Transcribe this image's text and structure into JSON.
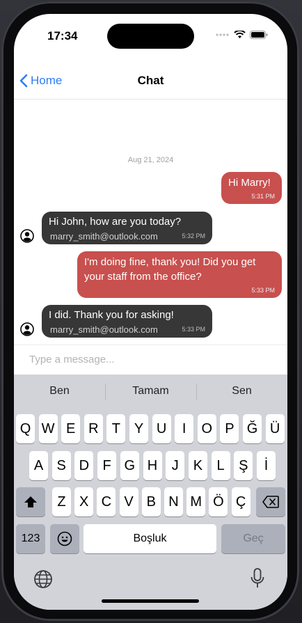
{
  "status": {
    "time": "17:34"
  },
  "nav": {
    "back_label": "Home",
    "title": "Chat"
  },
  "chat": {
    "date": "Aug 21, 2024",
    "messages": [
      {
        "dir": "out",
        "text": "Hi Marry!",
        "time": "5:31 PM"
      },
      {
        "dir": "in",
        "text": "Hi John, how are you today?",
        "sender": "marry_smith@outlook.com",
        "time": "5:32 PM"
      },
      {
        "dir": "out",
        "text": "I'm doing fine, thank you! Did you get your staff from the office?",
        "time": "5:33 PM"
      },
      {
        "dir": "in",
        "text": "I did. Thank you for asking!",
        "sender": "marry_smith@outlook.com",
        "time": "5:33 PM"
      }
    ]
  },
  "composer": {
    "placeholder": "Type a message..."
  },
  "keyboard": {
    "suggestions": [
      "Ben",
      "Tamam",
      "Sen"
    ],
    "row1": [
      "Q",
      "W",
      "E",
      "R",
      "T",
      "Y",
      "U",
      "I",
      "O",
      "P",
      "Ğ",
      "Ü"
    ],
    "row2": [
      "A",
      "S",
      "D",
      "F",
      "G",
      "H",
      "J",
      "K",
      "L",
      "Ş",
      "İ"
    ],
    "row3": [
      "Z",
      "X",
      "C",
      "V",
      "B",
      "N",
      "M",
      "Ö",
      "Ç"
    ],
    "numbers_label": "123",
    "space_label": "Boşluk",
    "return_label": "Geç",
    "icons": {
      "shift": "shift-icon",
      "delete": "backspace-icon",
      "emoji": "emoji-icon",
      "globe": "globe-icon",
      "mic": "microphone-icon"
    }
  },
  "colors": {
    "accent": "#2f7cf6",
    "outgoing": "#c8504e",
    "incoming": "#373737",
    "keyboard_bg": "#d1d3d9"
  }
}
